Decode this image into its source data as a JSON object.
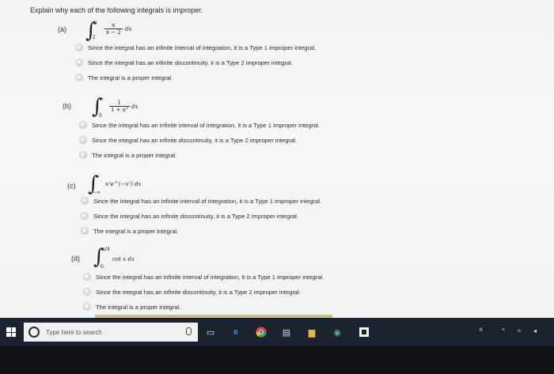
{
  "question": {
    "prompt": "Explain why each of the following integrals is improper."
  },
  "parts": [
    {
      "label": "(a)",
      "integral": {
        "upper": "3",
        "lower": "2",
        "numerator": "x",
        "denominator": "x − 2",
        "dx": "dx"
      },
      "options": [
        "Since the integral has an infinite interval of integration, it is a Type 1 improper integral.",
        "Since the integral has an infinite discontinuity, it is a Type 2 improper integral.",
        "The integral is a proper integral."
      ]
    },
    {
      "label": "(b)",
      "integral": {
        "upper": "∞",
        "lower": "0",
        "numerator": "1",
        "denominator": "1 + x³",
        "dx": "dx"
      },
      "options": [
        "Since the integral has an infinite interval of integration, it is a Type 1 improper integral.",
        "Since the integral has an infinite discontinuity, it is a Type 2 improper integral.",
        "The integral is a proper integral."
      ]
    },
    {
      "label": "(c)",
      "integral": {
        "upper": "∞",
        "lower": "−∞",
        "expression": "x²e^(−x²) dx"
      },
      "options": [
        "Since the integral has an infinite interval of integration, it is a Type 1 improper integral.",
        "Since the integral has an infinite discontinuity, it is a Type 2 improper integral.",
        "The integral is a proper integral."
      ]
    },
    {
      "label": "(d)",
      "integral": {
        "upper": "π/4",
        "lower": "0",
        "expression": "cot x dx"
      },
      "options": [
        "Since the integral has an infinite interval of integration, it is a Type 1 improper integral.",
        "Since the integral has an infinite discontinuity, it is a Type 2 improper integral.",
        "The integral is a proper integral."
      ]
    }
  ],
  "taskbar": {
    "search_placeholder": "Type here to search",
    "icons": [
      "windows-start-icon",
      "cortana-icon",
      "task-view-icon",
      "edge-icon",
      "chrome-icon",
      "store-icon",
      "file-explorer-icon",
      "app-icon",
      "onenote-icon"
    ],
    "tray": [
      "people-icon",
      "chevron-up-icon",
      "network-icon",
      "volume-icon"
    ]
  },
  "colors": {
    "taskbar": "#1b2230",
    "page": "#f4f4f4",
    "radio": "#d0d0d0"
  }
}
